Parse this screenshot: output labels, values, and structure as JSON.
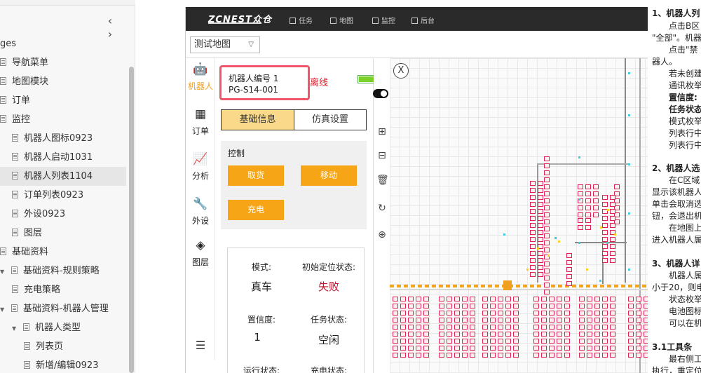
{
  "tree": {
    "prev_icon": "‹",
    "next_icon": "›",
    "title": "ges",
    "items": [
      {
        "label": "导航菜单",
        "level": 0,
        "type": "doc"
      },
      {
        "label": "地图模块",
        "level": 0,
        "type": "doc"
      },
      {
        "label": "订单",
        "level": 0,
        "type": "doc"
      },
      {
        "label": "监控",
        "level": 0,
        "type": "doc"
      },
      {
        "label": "机器人图标0923",
        "level": 1,
        "type": "doc"
      },
      {
        "label": "机器人启动1031",
        "level": 1,
        "type": "doc"
      },
      {
        "label": "机器人列表1104",
        "level": 1,
        "type": "doc",
        "selected": true
      },
      {
        "label": "订单列表0923",
        "level": 1,
        "type": "doc"
      },
      {
        "label": "外设0923",
        "level": 1,
        "type": "doc"
      },
      {
        "label": "图层",
        "level": 1,
        "type": "doc"
      },
      {
        "label": "基础资料",
        "level": 0,
        "type": "doc"
      },
      {
        "label": "基础资料-规则策略",
        "level": 0,
        "type": "folder"
      },
      {
        "label": "充电策略",
        "level": 1,
        "type": "doc"
      },
      {
        "label": "基础资料-机器人管理",
        "level": 0,
        "type": "folder"
      },
      {
        "label": "机器人类型",
        "level": 1,
        "type": "folder"
      },
      {
        "label": "列表页",
        "level": 2,
        "type": "doc"
      },
      {
        "label": "新增/编辑0923",
        "level": 2,
        "type": "doc"
      }
    ]
  },
  "app": {
    "logo": "ZCNEST众仓",
    "nav": [
      {
        "label": "任务",
        "icon": "document-icon"
      },
      {
        "label": "地图",
        "icon": "map-icon"
      },
      {
        "label": "监控",
        "icon": "monitor-icon"
      },
      {
        "label": "后台",
        "icon": "desktop-icon"
      }
    ],
    "map_select": {
      "value": "测试地图",
      "chevron": "▽"
    },
    "rail": [
      {
        "label": "机器人",
        "glyph": "🤖",
        "icon": "robot-icon",
        "active": true
      },
      {
        "label": "订单",
        "glyph": "▦",
        "icon": "calendar-icon",
        "active": false
      },
      {
        "label": "分析",
        "glyph": "📈",
        "icon": "analytics-icon",
        "active": false
      },
      {
        "label": "外设",
        "glyph": "🔧",
        "icon": "wrench-icon",
        "active": false
      },
      {
        "label": "图层",
        "glyph": "◈",
        "icon": "layers-icon",
        "active": false
      }
    ],
    "menu_glyph": "☰",
    "robot": {
      "id_label": "机器人编号 1",
      "code": "PG-S14-001",
      "status": "离线",
      "battery_text": "100",
      "battery_level": 1.0
    },
    "tabs": {
      "basic": "基础信息",
      "sim": "仿真设置"
    },
    "control": {
      "title": "控制",
      "pick": "取货",
      "move": "移动",
      "charge": "充电"
    },
    "status": {
      "mode_label": "模式:",
      "mode_value": "真车",
      "init_label": "初始定位状态:",
      "init_value": "失败",
      "confidence_label": "置信度:",
      "confidence_value": "1",
      "task_label": "任务状态:",
      "task_value": "空闲",
      "run_label": "运行状态:",
      "charge_label": "充电状态:"
    },
    "map_close": "X",
    "map_tools": [
      {
        "icon": "add-robot-icon",
        "glyph": "⊞"
      },
      {
        "icon": "remove-robot-icon",
        "glyph": "⊟"
      },
      {
        "icon": "delete-icon",
        "glyph": "🗑"
      },
      {
        "icon": "refresh-icon",
        "glyph": "↻"
      },
      {
        "icon": "locate-icon",
        "glyph": "⊕"
      }
    ]
  },
  "doc_pane": {
    "lines": [
      {
        "text": "1、机器人列",
        "style": "h"
      },
      {
        "text": "点击B区",
        "style": "i"
      },
      {
        "text": "\"全部\"。机器",
        "style": ""
      },
      {
        "text": "点击\"禁",
        "style": "i"
      },
      {
        "text": "器人。",
        "style": ""
      },
      {
        "text": "若未创建",
        "style": "i2"
      },
      {
        "text": "通讯枚举",
        "style": "i2"
      },
      {
        "text": "置信度:",
        "style": "b"
      },
      {
        "text": "任务状态",
        "style": "b"
      },
      {
        "text": "模式枚举",
        "style": "i2"
      },
      {
        "text": "列表行中",
        "style": "i2"
      },
      {
        "text": "列表行中",
        "style": "i2"
      },
      {
        "text": "2、机器人选",
        "style": "h"
      },
      {
        "text": "在C区域",
        "style": "i"
      },
      {
        "text": "显示该机器人",
        "style": ""
      },
      {
        "text": "单击会取消选",
        "style": ""
      },
      {
        "text": "钮，会退出机",
        "style": ""
      },
      {
        "text": "在地图上",
        "style": "i"
      },
      {
        "text": "进入机器人属",
        "style": ""
      },
      {
        "text": "3、机器人详",
        "style": "h"
      },
      {
        "text": "机器人属",
        "style": "i"
      },
      {
        "text": "小于20，则电",
        "style": ""
      },
      {
        "text": "状态枚举",
        "style": "i"
      },
      {
        "text": "电池图标",
        "style": "i"
      },
      {
        "text": "可以在机",
        "style": "i"
      },
      {
        "text": "3.1工具条",
        "style": "h"
      },
      {
        "text": "最右侧工",
        "style": "i"
      },
      {
        "text": "执行，重定位",
        "style": ""
      }
    ]
  },
  "colors": {
    "accent_orange": "#f5a516",
    "tab_active": "#fbd98a",
    "highlight_box": "#f0566a",
    "offline_red": "#d12",
    "fail_red": "#c0102a",
    "topbar": "#2a2a2a"
  }
}
